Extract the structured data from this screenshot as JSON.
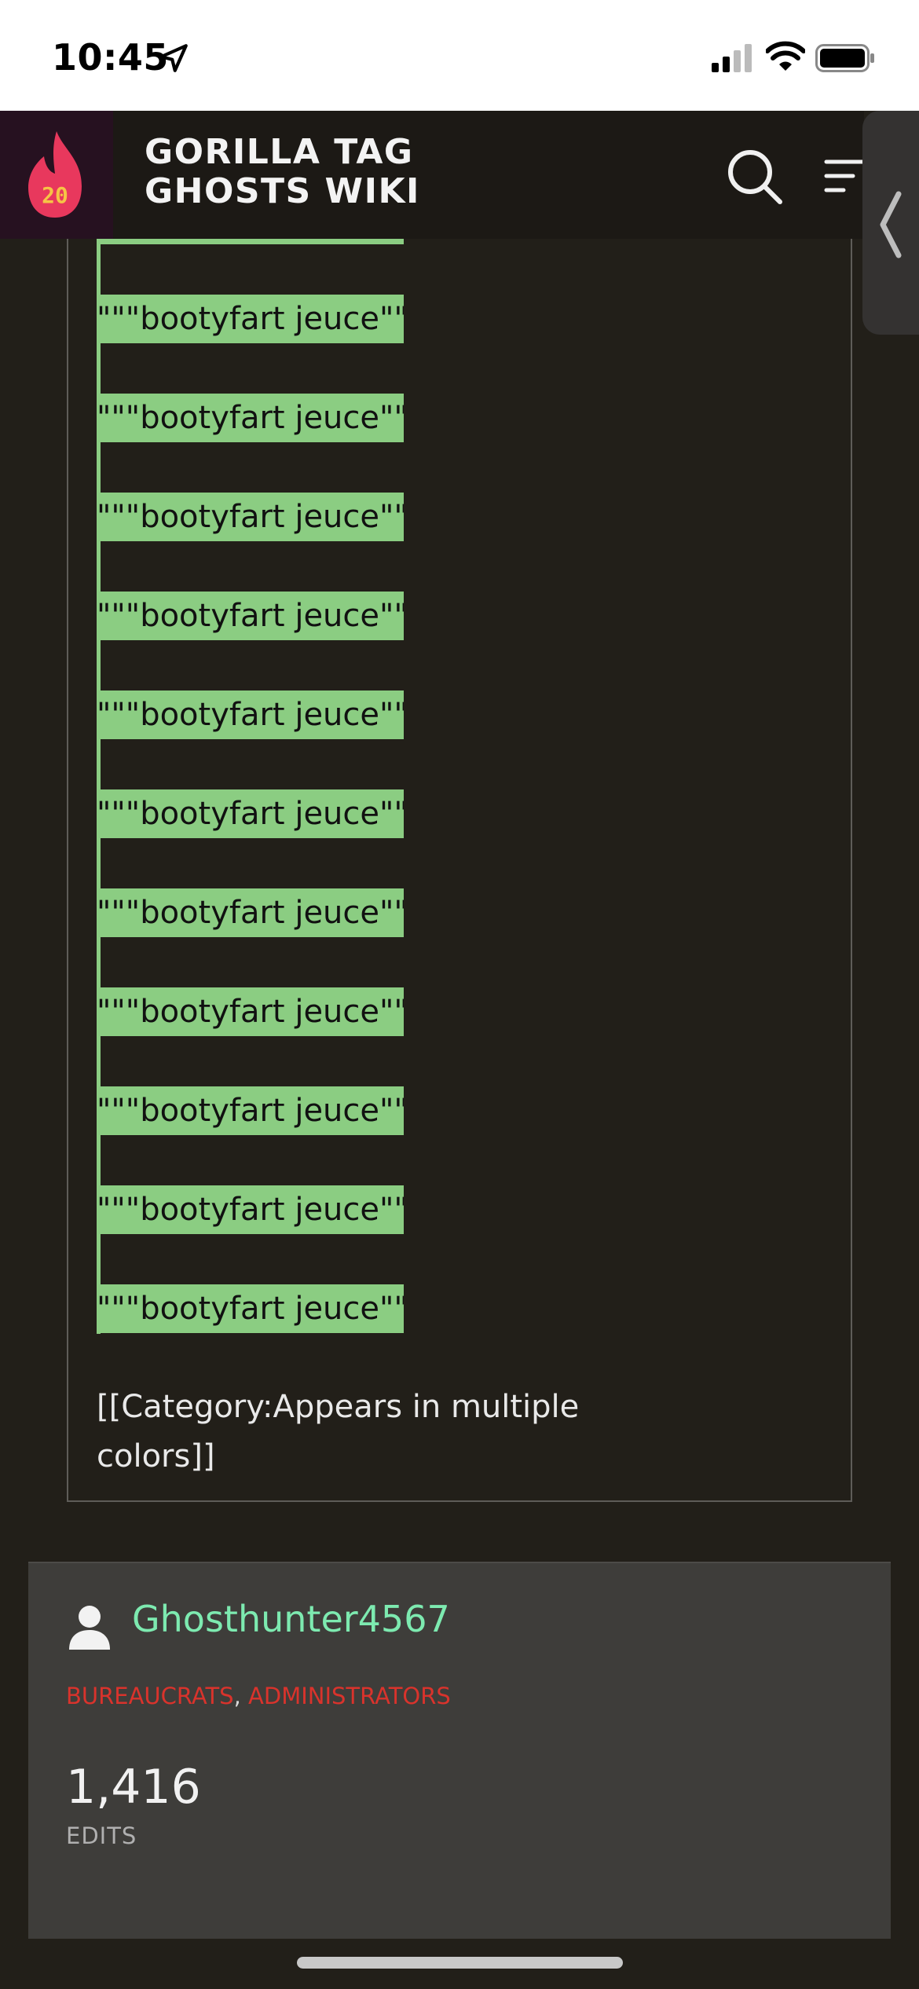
{
  "status_bar": {
    "time": "10:45",
    "location_icon": "location-arrow-icon",
    "signal_icon": "cellular-signal-icon",
    "wifi_icon": "wifi-icon",
    "battery_icon": "battery-icon"
  },
  "header": {
    "logo_text": "20",
    "wiki_title": "GORILLA TAG GHOSTS WIKI",
    "search_icon": "search-icon",
    "menu_icon": "menu-icon"
  },
  "side_tab": {
    "icon": "chevron-left-icon"
  },
  "content": {
    "lines": [
      "\"\"\"bootyfart jeuce\"\"\"",
      "\"\"\"bootyfart jeuce\"\"\"",
      "\"\"\"bootyfart jeuce\"\"\"",
      "\"\"\"bootyfart jeuce\"\"\"",
      "\"\"\"bootyfart jeuce\"\"\"",
      "\"\"\"bootyfart jeuce\"\"\"",
      "\"\"\"bootyfart jeuce\"\"\"",
      "\"\"\"bootyfart jeuce\"\"\"",
      "\"\"\"bootyfart jeuce\"\"\"",
      "\"\"\"bootyfart jeuce\"\"\"",
      "\"\"\"bootyfart jeuce\"\"\""
    ],
    "category": "[[Category:Appears in multiple colors]]"
  },
  "user_card": {
    "username": "Ghosthunter4567",
    "groups": [
      "BUREAUCRATS",
      "ADMINISTRATORS"
    ],
    "separator": ", ",
    "edit_count": "1,416",
    "edit_label": "EDITS"
  },
  "colors": {
    "highlight": "#8bcd82",
    "username": "#7deab0",
    "group": "#d9332c",
    "background": "#221f19",
    "card": "#3e3d3a"
  }
}
